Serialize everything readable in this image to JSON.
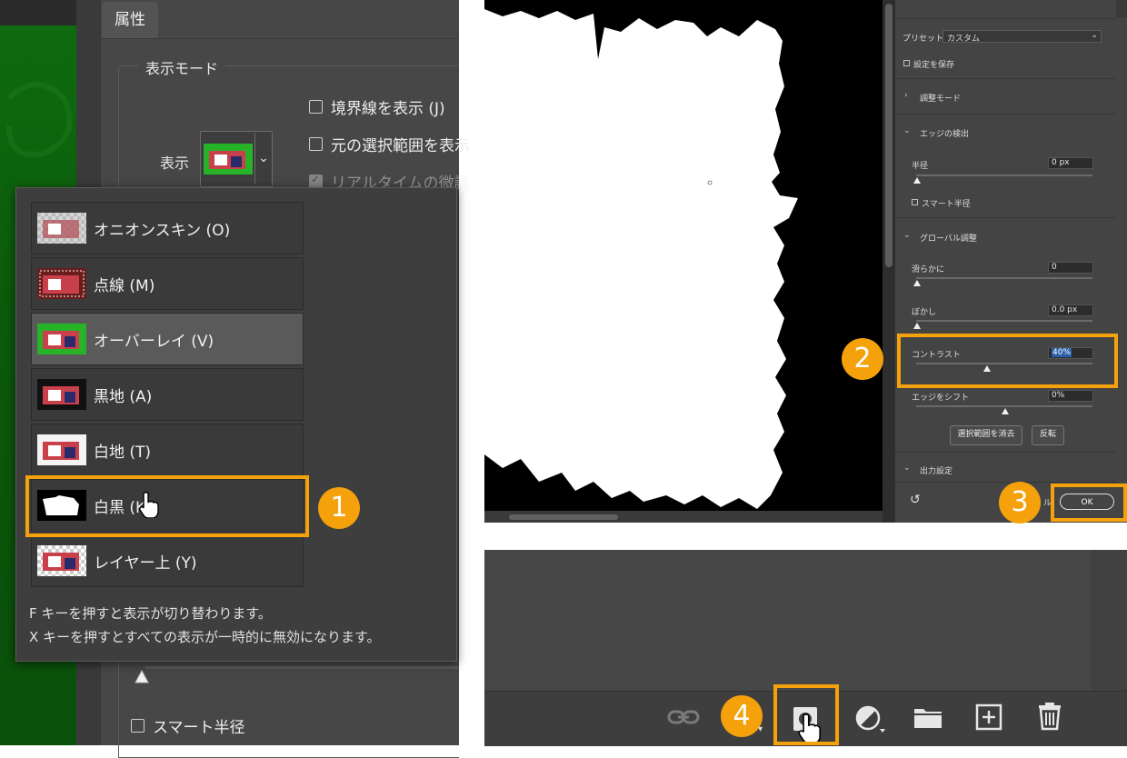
{
  "properties_panel": {
    "tab_label": "属性",
    "display_mode_legend": "表示モード",
    "show_label": "表示",
    "checkboxes": [
      {
        "label": "境界線を表示 (J)",
        "checked": false,
        "disabled": false
      },
      {
        "label": "元の選択範囲を表示",
        "checked": false,
        "disabled": false
      },
      {
        "label": "リアルタイムの微調",
        "checked": true,
        "disabled": true
      }
    ],
    "smart_radius_label": "スマート半径"
  },
  "view_dropdown": {
    "items": [
      {
        "label": "オニオンスキン (O)",
        "thumb": "onion-skin"
      },
      {
        "label": "点線 (M)",
        "thumb": "marching-ants"
      },
      {
        "label": "オーバーレイ (V)",
        "thumb": "overlay",
        "selected": true
      },
      {
        "label": "黒地 (A)",
        "thumb": "on-black"
      },
      {
        "label": "白地 (T)",
        "thumb": "on-white"
      },
      {
        "label": "白黒 (K)",
        "thumb": "black-white",
        "highlighted": true
      },
      {
        "label": "レイヤー上 (Y)",
        "thumb": "on-layers"
      }
    ],
    "hint_f": "F キーを押すと表示が切り替わります。",
    "hint_x": "X キーを押すとすべての表示が一時的に無効になります。"
  },
  "select_mask_panel": {
    "preset_label": "プリセット",
    "preset_value": "カスタム",
    "save_settings_label": "設定を保存",
    "adjust_mode_label": "調整モード",
    "edge_detection_label": "エッジの検出",
    "radius_label": "半径",
    "radius_value": "0 px",
    "smart_radius_label": "スマート半径",
    "global_refine_label": "グローバル調整",
    "smooth_label": "滑らかに",
    "smooth_value": "0",
    "feather_label": "ぼかし",
    "feather_value": "0.0 px",
    "contrast_label": "コントラスト",
    "contrast_value": "40%",
    "contrast_level": 0.4,
    "shift_edge_label": "エッジをシフト",
    "shift_edge_value": "0%",
    "clear_selection_button": "選択範囲を消去",
    "invert_button": "反転",
    "output_settings_label": "出力設定",
    "cancel_partial": "ル",
    "ok_button": "OK"
  },
  "badges": {
    "one": "1",
    "two": "2",
    "three": "3",
    "four": "4"
  },
  "colors": {
    "highlight": "#f5a10b",
    "panel": "#474747",
    "dark_panel": "#3a3a3a"
  },
  "layers_toolbar": {
    "icons": [
      "link-icon",
      "add-mask-icon",
      "adjustment-layer-icon",
      "folder-icon",
      "new-layer-icon",
      "trash-icon"
    ]
  }
}
